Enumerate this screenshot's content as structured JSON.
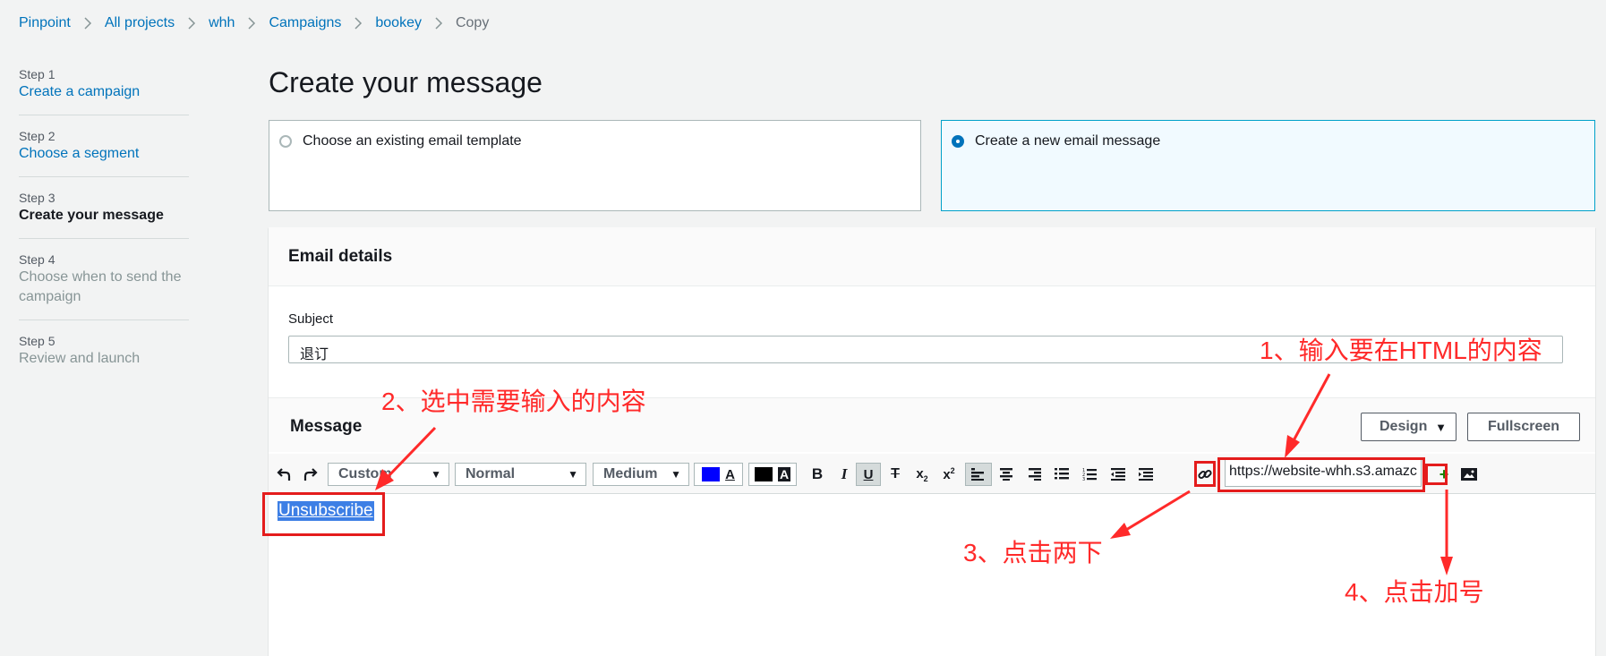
{
  "breadcrumb": {
    "items": [
      "Pinpoint",
      "All projects",
      "whh",
      "Campaigns",
      "bookey"
    ],
    "current": "Copy"
  },
  "steps": [
    {
      "num": "Step 1",
      "title": "Create a campaign"
    },
    {
      "num": "Step 2",
      "title": "Choose a segment"
    },
    {
      "num": "Step 3",
      "title": "Create your message"
    },
    {
      "num": "Step 4",
      "title_line1": "Choose when to send the",
      "title_line2": "campaign"
    },
    {
      "num": "Step 5",
      "title": "Review and launch"
    }
  ],
  "page_title": "Create your message",
  "tiles": {
    "existing": "Choose an existing email template",
    "new": "Create a new email message",
    "selected": "new"
  },
  "email_details": {
    "header": "Email details",
    "subject_label": "Subject",
    "subject_value": "退订"
  },
  "message": {
    "title": "Message",
    "design_label": "Design",
    "fullscreen_label": "Fullscreen"
  },
  "toolbar": {
    "font_select": "Custom",
    "format_select": "Normal",
    "size_select": "Medium",
    "text_color": "#0000ff",
    "bg_color": "#000000",
    "url_value": "https://website-whh.s3.amazc"
  },
  "editor": {
    "content": "Unsubscribe"
  },
  "annotations": {
    "step1": "1、输入要在HTML的内容",
    "step2": "2、选中需要输入的内容",
    "step3": "3、点击两下",
    "step4": "4、点击加号",
    "color": "#ff2a2a"
  }
}
